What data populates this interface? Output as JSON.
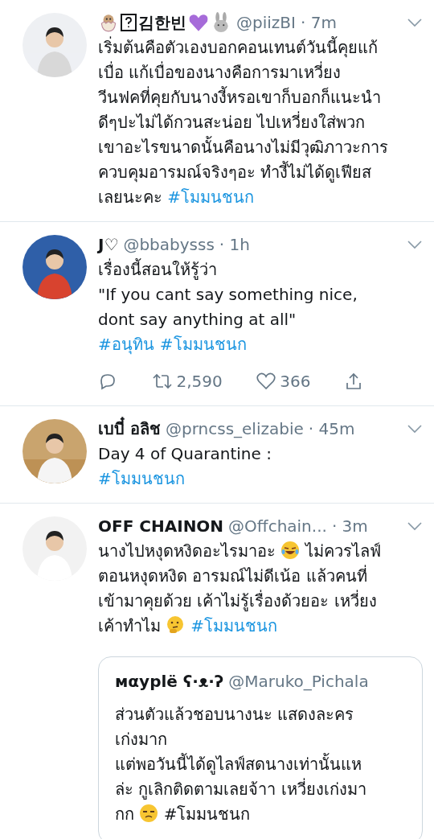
{
  "tweets": [
    {
      "name": [
        {
          "kind": "chick"
        },
        {
          "kind": "missing-glyph"
        },
        {
          "kind": "text",
          "text": "김한빈"
        },
        {
          "kind": "heart"
        },
        {
          "kind": "rabbit"
        }
      ],
      "handle": "@piizBI",
      "time": "· 7m",
      "avatar": {
        "kind": "picture"
      },
      "body": [
        [
          {
            "kind": "text",
            "text": "เริ่มต้นคือตัวเองบอกคอนเทนต์วันนี้คุยแก้"
          }
        ],
        [
          {
            "kind": "text",
            "text": "เบื่อ แก้เบื่อของนางคือการมาเหวี่ยง"
          }
        ],
        [
          {
            "kind": "text",
            "text": "วีนฟคที่คุยกับนางงี้หรอเขาก็บอกก็แนะนำ"
          }
        ],
        [
          {
            "kind": "text",
            "text": "ดีๆปะไม่ได้กวนสะน่อย ไปเหวี่ยงใส่พวก"
          }
        ],
        [
          {
            "kind": "text",
            "text": "เขาอะไรขนาดนั้นคือนางไม่มีวุฒิภาวะการ"
          }
        ],
        [
          {
            "kind": "text",
            "text": "ควบคุมอารมณ์จริงๆอะ ทำงี้ไม่ได้ดูเฟียส"
          }
        ],
        [
          {
            "kind": "text",
            "text": "เลยนะคะ "
          },
          {
            "kind": "hashtag",
            "text": "#โมมนชนก"
          }
        ]
      ]
    },
    {
      "name": [
        {
          "kind": "text",
          "text": "J♡"
        }
      ],
      "handle": "@bbabysss",
      "time": "· 1h",
      "avatar": {
        "kind": "picture"
      },
      "body": [
        [
          {
            "kind": "text",
            "text": "เรื่องนี้สอนให้รู้ว่า"
          }
        ],
        [
          {
            "kind": "text",
            "text": "\"If you cant say something nice,"
          }
        ],
        [
          {
            "kind": "text",
            "text": "dont say anything at all\""
          }
        ],
        [
          {
            "kind": "hashtag",
            "text": "#อนุทิน"
          },
          {
            "kind": "hashtag",
            "text": "#โมมนชนก"
          }
        ]
      ],
      "actions": [
        {
          "kind": "reply"
        },
        {
          "kind": "retweet",
          "count": "2,590"
        },
        {
          "kind": "like",
          "count": "366"
        },
        {
          "kind": "share"
        }
      ]
    },
    {
      "name": [
        {
          "kind": "text",
          "text": "เบบี๋ อลิช"
        }
      ],
      "handle": "@prncss_elizabie",
      "time": "· 45m",
      "avatar": {
        "kind": "picture"
      },
      "body": [
        [
          {
            "kind": "text",
            "text": "Day 4 of Quarantine :"
          }
        ],
        [
          {
            "kind": "hashtag",
            "text": "#โมมนชนก"
          }
        ]
      ]
    },
    {
      "name": [
        {
          "kind": "text",
          "text": "OFF CHAINON"
        }
      ],
      "handle": "@Offchain...",
      "time": "· 3m",
      "avatar": {
        "kind": "picture"
      },
      "body": [
        [
          {
            "kind": "text",
            "text": "นางไปหงุดหงิดอะไรมาอะ "
          },
          {
            "kind": "laughing"
          },
          {
            "kind": "text",
            "text": " ไม่ควรไลฟ์"
          }
        ],
        [
          {
            "kind": "text",
            "text": "ตอนหงุดหงิด อารมณ์ไม่ดีเน้อ แล้วคนที่"
          }
        ],
        [
          {
            "kind": "text",
            "text": "เข้ามาคุยด้วย เค้าไม่รู้เรื่องด้วยอะ เหวี่ยง"
          }
        ],
        [
          {
            "kind": "text",
            "text": "เค้าทำไม "
          },
          {
            "kind": "thinking"
          },
          {
            "kind": "hashtag",
            "text": "#โมมนชนก"
          }
        ]
      ],
      "quote": {
        "name": "ᴍαyplë ʕ·ᴥ·ʔ",
        "handle": "@Maruko_Pichala",
        "body": [
          [
            {
              "kind": "text",
              "text": "ส่วนตัวแล้วชอบนางนะ แสดงละคร"
            }
          ],
          [
            {
              "kind": "text",
              "text": "เก่งมาก"
            }
          ],
          [
            {
              "kind": "text",
              "text": "แต่พอวันนี้ได้ดูไลฟ์สดนางเท่านั้นแห"
            }
          ],
          [
            {
              "kind": "text",
              "text": "ล่ะ กูเลิกติดตามเลยจ้าา เหวี่ยงเก่งมา"
            }
          ],
          [
            {
              "kind": "text",
              "text": "กก "
            },
            {
              "kind": "unamused"
            },
            {
              "kind": "text",
              "text": " #โมมนชนก"
            }
          ]
        ]
      }
    }
  ]
}
